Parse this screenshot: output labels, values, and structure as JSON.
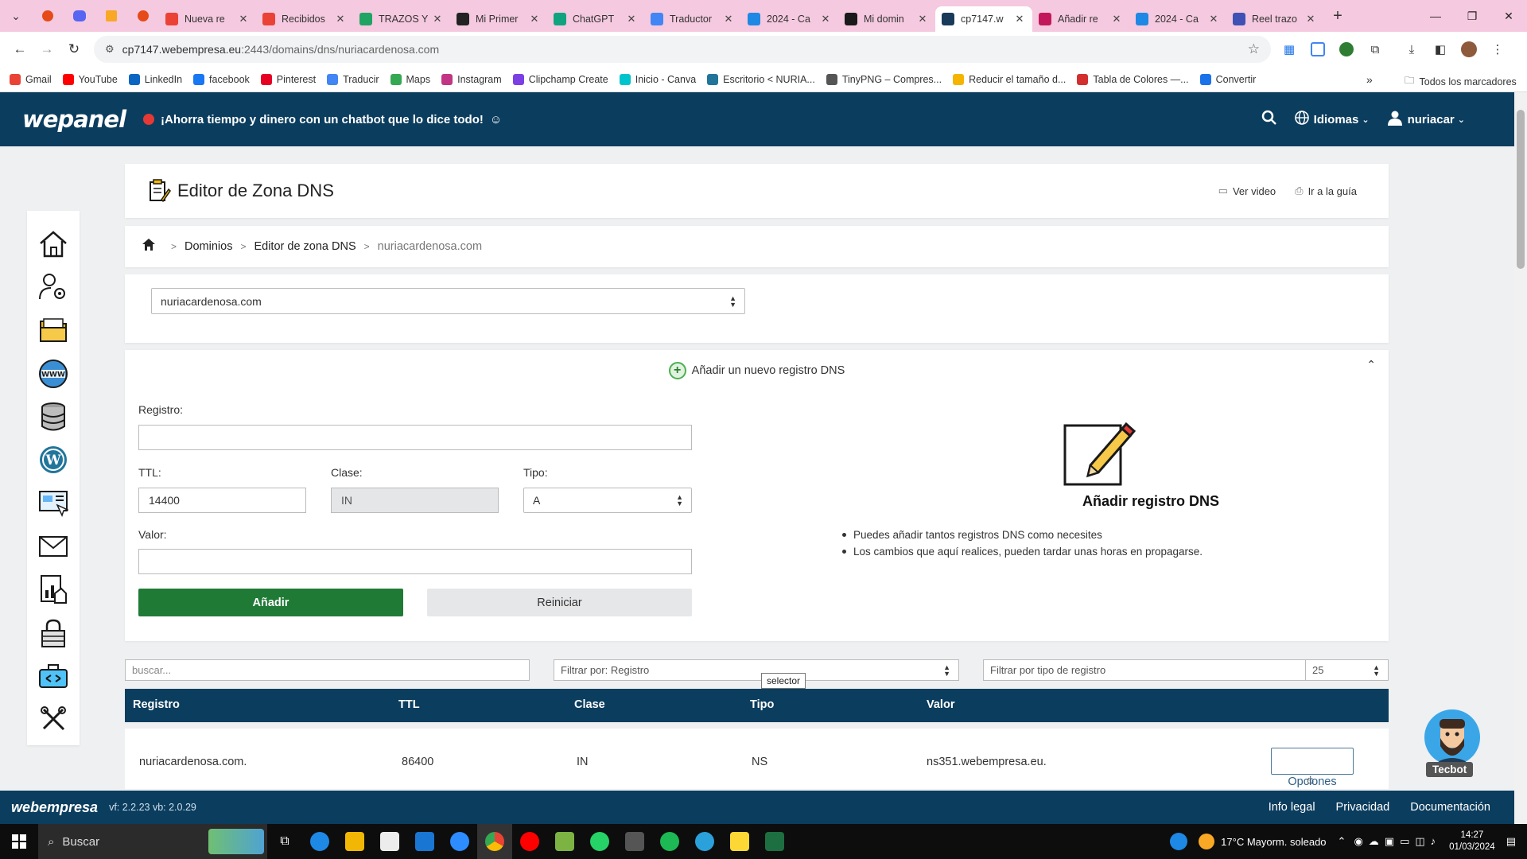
{
  "browser": {
    "tabs": [
      {
        "title": "Nueva re",
        "icon": "gmail-icon",
        "color": "#ea4335"
      },
      {
        "title": "Recibidos",
        "icon": "gmail-icon",
        "color": "#ea4335"
      },
      {
        "title": "TRAZOS Y",
        "icon": "drive-icon",
        "color": "#1fa463"
      },
      {
        "title": "Mi Primer",
        "icon": "amazon-icon",
        "color": "#222222"
      },
      {
        "title": "ChatGPT",
        "icon": "chatgpt-icon",
        "color": "#10a37f"
      },
      {
        "title": "Traductor",
        "icon": "translate-icon",
        "color": "#4285f4"
      },
      {
        "title": "2024 - Ca",
        "icon": "canva-icon",
        "color": "#1e88e5"
      },
      {
        "title": "Mi domin",
        "icon": "webempresa-icon",
        "color": "#1a1a1a"
      },
      {
        "title": "cp7147.w",
        "icon": "webempresa-icon",
        "color": "#1a3a5a",
        "active": true
      },
      {
        "title": "Añadir re",
        "icon": "webempresa-icon",
        "color": "#c2185b"
      },
      {
        "title": "2024 - Ca",
        "icon": "canva-icon",
        "color": "#1e88e5"
      },
      {
        "title": "Reel trazo",
        "icon": "clipchamp-icon",
        "color": "#3f51b5"
      }
    ],
    "url_host": "cp7147.webempresa.eu",
    "url_path": ":2443/domains/dns/nuriacardenosa.com"
  },
  "bookmarks": [
    {
      "label": "Gmail",
      "color": "#ea4335"
    },
    {
      "label": "YouTube",
      "color": "#ff0000"
    },
    {
      "label": "LinkedIn",
      "color": "#0a66c2"
    },
    {
      "label": "facebook",
      "color": "#1877f2"
    },
    {
      "label": "Pinterest",
      "color": "#e60023"
    },
    {
      "label": "Traducir",
      "color": "#4285f4"
    },
    {
      "label": "Maps",
      "color": "#34a853"
    },
    {
      "label": "Instagram",
      "color": "#c13584"
    },
    {
      "label": "Clipchamp Create",
      "color": "#7b3fe4"
    },
    {
      "label": "Inicio - Canva",
      "color": "#00c4cc"
    },
    {
      "label": "Escritorio < NURIA...",
      "color": "#21759b"
    },
    {
      "label": "TinyPNG – Compres...",
      "color": "#555555"
    },
    {
      "label": "Reducir el tamaño d...",
      "color": "#f4b400"
    },
    {
      "label": "Tabla de Colores —...",
      "color": "#d32f2f"
    },
    {
      "label": "Convertir",
      "color": "#1a73e8"
    }
  ],
  "bookmarks_all": "Todos los marcadores",
  "header": {
    "logo": "wepanel",
    "promo": "¡Ahorra tiempo y dinero con un chatbot que lo dice todo!",
    "languages": "Idiomas",
    "user": "nuriacar"
  },
  "page": {
    "title": "Editor de Zona DNS",
    "video_link": "Ver video",
    "guide_link": "Ir a la guía",
    "breadcrumb": [
      "Dominios",
      "Editor de zona DNS",
      "nuriacardenosa.com"
    ],
    "domain_selected": "nuriacardenosa.com"
  },
  "form": {
    "heading": "Añadir un nuevo registro DNS",
    "registro_label": "Registro:",
    "registro_value": "",
    "ttl_label": "TTL:",
    "ttl_value": "14400",
    "clase_label": "Clase:",
    "clase_value": "IN",
    "tipo_label": "Tipo:",
    "tipo_value": "A",
    "valor_label": "Valor:",
    "valor_value": "",
    "add_button": "Añadir",
    "reset_button": "Reiniciar"
  },
  "info": {
    "title": "Añadir registro DNS",
    "bullets": [
      "Puedes añadir tantos registros DNS como necesites",
      "Los cambios que aquí realices, pueden tardar unas horas en propagarse."
    ]
  },
  "filters": {
    "search_placeholder": "buscar...",
    "filter_by": "Filtrar por: Registro",
    "filter_type": "Filtrar por tipo de registro",
    "page_size": "25",
    "tooltip": "selector"
  },
  "table": {
    "headers": [
      "Registro",
      "TTL",
      "Clase",
      "Tipo",
      "Valor"
    ],
    "rows": [
      {
        "registro": "nuriacardenosa.com.",
        "ttl": "86400",
        "clase": "IN",
        "tipo": "NS",
        "valor": "ns351.webempresa.eu.",
        "action": "Opciones"
      }
    ]
  },
  "chatbot": {
    "label": "Tecbot"
  },
  "footer": {
    "logo": "webempresa",
    "version": "vf: 2.2.23 vb: 2.0.29",
    "links": [
      "Info legal",
      "Privacidad",
      "Documentación"
    ]
  },
  "taskbar": {
    "search": "Buscar",
    "weather": "17°C  Mayorm. soleado",
    "time": "14:27",
    "date": "01/03/2024"
  },
  "colors": {
    "brand_navy": "#0b3d5e",
    "add_green": "#1f7a36",
    "tab_strip": "#f5c9df"
  }
}
